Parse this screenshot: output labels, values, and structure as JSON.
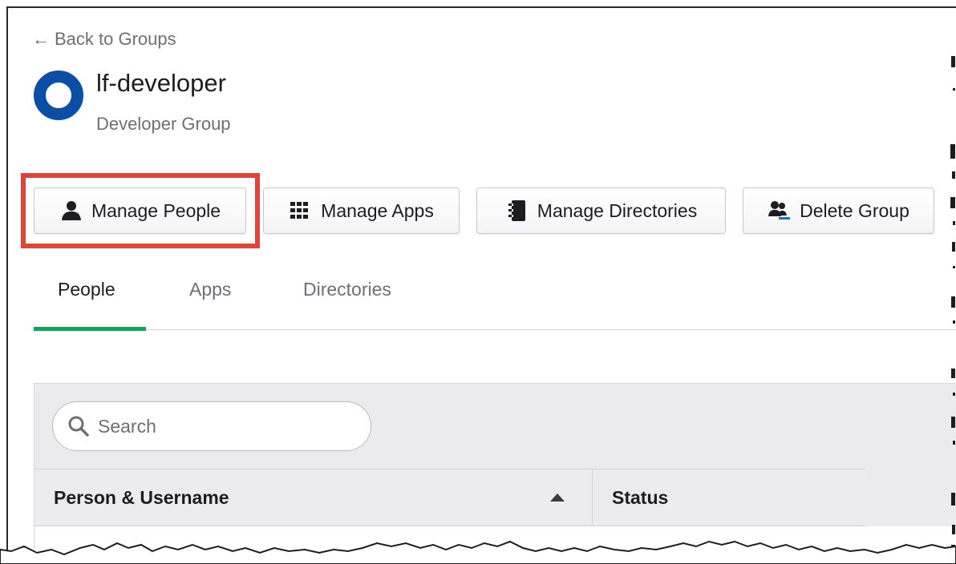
{
  "back_link": {
    "arrow": "←",
    "label": "Back to Groups"
  },
  "group": {
    "name": "lf-developer",
    "description": "Developer Group"
  },
  "actions": [
    {
      "label": "Manage People",
      "icon": "person-icon"
    },
    {
      "label": "Manage Apps",
      "icon": "grid-icon"
    },
    {
      "label": "Manage Directories",
      "icon": "directory-book-icon"
    },
    {
      "label": "Delete Group",
      "icon": "delete-group-icon"
    }
  ],
  "tabs": [
    {
      "label": "People",
      "active": true
    },
    {
      "label": "Apps",
      "active": false
    },
    {
      "label": "Directories",
      "active": false
    }
  ],
  "search": {
    "placeholder": "Search",
    "value": ""
  },
  "table": {
    "columns": [
      "Person & Username",
      "Status"
    ],
    "sort_column": "Person & Username",
    "sort_direction": "ascending"
  },
  "colors": {
    "highlight": "#e0453b",
    "tab_underline": "#1e9e5a",
    "group_icon": "#0a4fa5"
  }
}
